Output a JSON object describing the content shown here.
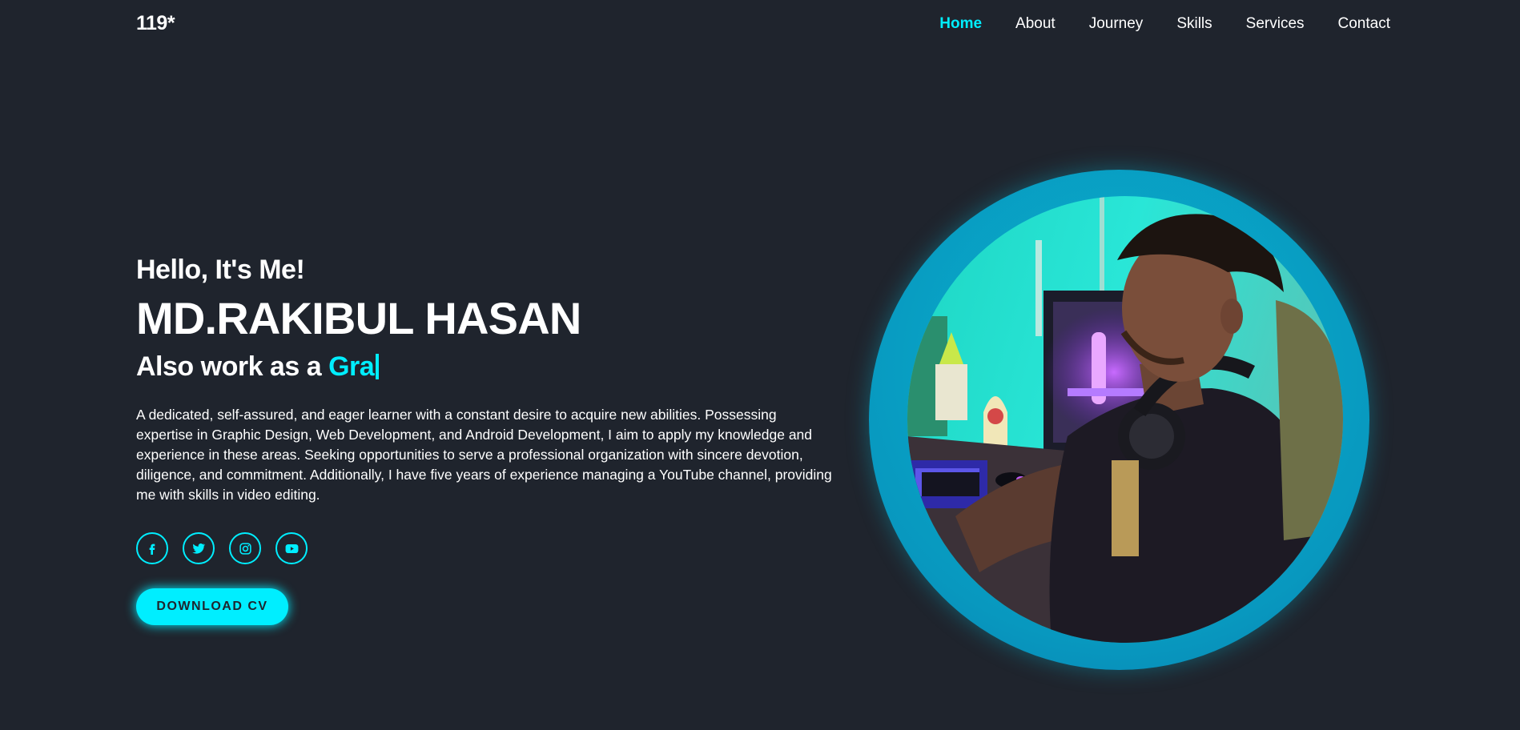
{
  "header": {
    "logo": "119*",
    "nav": [
      "Home",
      "About",
      "Journey",
      "Skills",
      "Services",
      "Contact"
    ],
    "active_nav": "Home"
  },
  "home": {
    "greeting": "Hello, It's Me!",
    "name": "MD.RAKIBUL HASAN",
    "role_prefix": "Also work as a",
    "role_typed": "Gra",
    "description": "A dedicated, self-assured, and eager learner with a constant desire to acquire new abilities. Possessing expertise in Graphic Design, Web Development, and Android Development, I aim to apply my knowledge and experience in these areas. Seeking opportunities to serve a professional organization with sincere devotion, diligence, and commitment. Additionally, I have five years of experience managing a YouTube channel, providing me with skills in video editing.",
    "socials": [
      "facebook-icon",
      "twitter-icon",
      "instagram-icon",
      "youtube-icon"
    ],
    "cv_button": "DOWNLOAD CV"
  },
  "colors": {
    "background": "#1f242d",
    "accent": "#00eeff",
    "text": "#ffffff"
  }
}
